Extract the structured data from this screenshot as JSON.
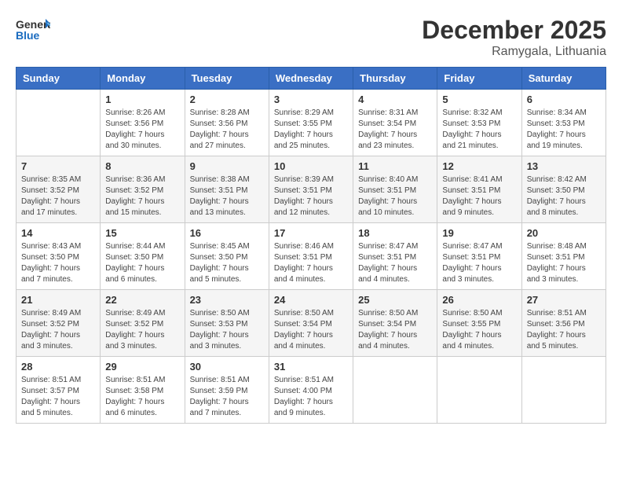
{
  "header": {
    "logo_line1": "General",
    "logo_line2": "Blue",
    "month": "December 2025",
    "location": "Ramygala, Lithuania"
  },
  "days_of_week": [
    "Sunday",
    "Monday",
    "Tuesday",
    "Wednesday",
    "Thursday",
    "Friday",
    "Saturday"
  ],
  "weeks": [
    [
      {
        "day": "",
        "info": ""
      },
      {
        "day": "1",
        "info": "Sunrise: 8:26 AM\nSunset: 3:56 PM\nDaylight: 7 hours\nand 30 minutes."
      },
      {
        "day": "2",
        "info": "Sunrise: 8:28 AM\nSunset: 3:56 PM\nDaylight: 7 hours\nand 27 minutes."
      },
      {
        "day": "3",
        "info": "Sunrise: 8:29 AM\nSunset: 3:55 PM\nDaylight: 7 hours\nand 25 minutes."
      },
      {
        "day": "4",
        "info": "Sunrise: 8:31 AM\nSunset: 3:54 PM\nDaylight: 7 hours\nand 23 minutes."
      },
      {
        "day": "5",
        "info": "Sunrise: 8:32 AM\nSunset: 3:53 PM\nDaylight: 7 hours\nand 21 minutes."
      },
      {
        "day": "6",
        "info": "Sunrise: 8:34 AM\nSunset: 3:53 PM\nDaylight: 7 hours\nand 19 minutes."
      }
    ],
    [
      {
        "day": "7",
        "info": "Sunrise: 8:35 AM\nSunset: 3:52 PM\nDaylight: 7 hours\nand 17 minutes."
      },
      {
        "day": "8",
        "info": "Sunrise: 8:36 AM\nSunset: 3:52 PM\nDaylight: 7 hours\nand 15 minutes."
      },
      {
        "day": "9",
        "info": "Sunrise: 8:38 AM\nSunset: 3:51 PM\nDaylight: 7 hours\nand 13 minutes."
      },
      {
        "day": "10",
        "info": "Sunrise: 8:39 AM\nSunset: 3:51 PM\nDaylight: 7 hours\nand 12 minutes."
      },
      {
        "day": "11",
        "info": "Sunrise: 8:40 AM\nSunset: 3:51 PM\nDaylight: 7 hours\nand 10 minutes."
      },
      {
        "day": "12",
        "info": "Sunrise: 8:41 AM\nSunset: 3:51 PM\nDaylight: 7 hours\nand 9 minutes."
      },
      {
        "day": "13",
        "info": "Sunrise: 8:42 AM\nSunset: 3:50 PM\nDaylight: 7 hours\nand 8 minutes."
      }
    ],
    [
      {
        "day": "14",
        "info": "Sunrise: 8:43 AM\nSunset: 3:50 PM\nDaylight: 7 hours\nand 7 minutes."
      },
      {
        "day": "15",
        "info": "Sunrise: 8:44 AM\nSunset: 3:50 PM\nDaylight: 7 hours\nand 6 minutes."
      },
      {
        "day": "16",
        "info": "Sunrise: 8:45 AM\nSunset: 3:50 PM\nDaylight: 7 hours\nand 5 minutes."
      },
      {
        "day": "17",
        "info": "Sunrise: 8:46 AM\nSunset: 3:51 PM\nDaylight: 7 hours\nand 4 minutes."
      },
      {
        "day": "18",
        "info": "Sunrise: 8:47 AM\nSunset: 3:51 PM\nDaylight: 7 hours\nand 4 minutes."
      },
      {
        "day": "19",
        "info": "Sunrise: 8:47 AM\nSunset: 3:51 PM\nDaylight: 7 hours\nand 3 minutes."
      },
      {
        "day": "20",
        "info": "Sunrise: 8:48 AM\nSunset: 3:51 PM\nDaylight: 7 hours\nand 3 minutes."
      }
    ],
    [
      {
        "day": "21",
        "info": "Sunrise: 8:49 AM\nSunset: 3:52 PM\nDaylight: 7 hours\nand 3 minutes."
      },
      {
        "day": "22",
        "info": "Sunrise: 8:49 AM\nSunset: 3:52 PM\nDaylight: 7 hours\nand 3 minutes."
      },
      {
        "day": "23",
        "info": "Sunrise: 8:50 AM\nSunset: 3:53 PM\nDaylight: 7 hours\nand 3 minutes."
      },
      {
        "day": "24",
        "info": "Sunrise: 8:50 AM\nSunset: 3:54 PM\nDaylight: 7 hours\nand 4 minutes."
      },
      {
        "day": "25",
        "info": "Sunrise: 8:50 AM\nSunset: 3:54 PM\nDaylight: 7 hours\nand 4 minutes."
      },
      {
        "day": "26",
        "info": "Sunrise: 8:50 AM\nSunset: 3:55 PM\nDaylight: 7 hours\nand 4 minutes."
      },
      {
        "day": "27",
        "info": "Sunrise: 8:51 AM\nSunset: 3:56 PM\nDaylight: 7 hours\nand 5 minutes."
      }
    ],
    [
      {
        "day": "28",
        "info": "Sunrise: 8:51 AM\nSunset: 3:57 PM\nDaylight: 7 hours\nand 5 minutes."
      },
      {
        "day": "29",
        "info": "Sunrise: 8:51 AM\nSunset: 3:58 PM\nDaylight: 7 hours\nand 6 minutes."
      },
      {
        "day": "30",
        "info": "Sunrise: 8:51 AM\nSunset: 3:59 PM\nDaylight: 7 hours\nand 7 minutes."
      },
      {
        "day": "31",
        "info": "Sunrise: 8:51 AM\nSunset: 4:00 PM\nDaylight: 7 hours\nand 9 minutes."
      },
      {
        "day": "",
        "info": ""
      },
      {
        "day": "",
        "info": ""
      },
      {
        "day": "",
        "info": ""
      }
    ]
  ]
}
